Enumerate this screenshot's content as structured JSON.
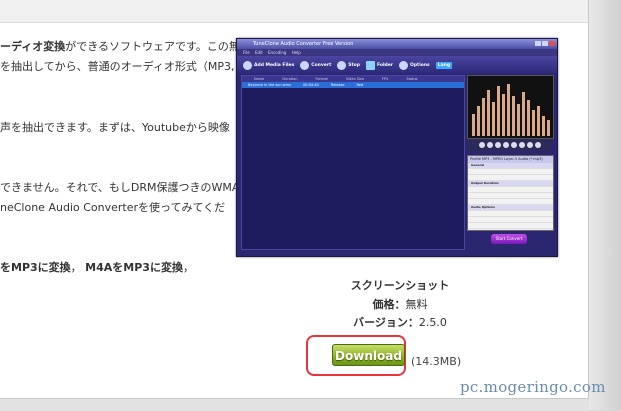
{
  "article": {
    "line1_a": "ーディオ変換",
    "line1_b": "ができるソフトウェアです。この無料",
    "line2": "を抽出してから、普通のオーディオ形式（MP3,",
    "line3": "声を抽出できます。まずは、Youtubeから映像",
    "line4": "できません。それで、もしDRM保護つきのWMAと",
    "line5": "neClone Audio Converterを使ってみてくだ",
    "line6_a": "をMP3に変換",
    "line6_b": "，",
    "line6_c": "M4AをMP3に変換",
    "line6_d": "，"
  },
  "app_screenshot": {
    "title": "TuneClone Audio Converter Free Version",
    "menu": "File  Edit  Encoding  Help",
    "toolbar": [
      "Add Media Files",
      "Convert",
      "Stop",
      "Folder",
      "Options"
    ],
    "lang_badge": "Lang",
    "list_headers": [
      "Name",
      "Duration",
      "Format",
      "Video Size",
      "FPS",
      "Status"
    ],
    "list_row": [
      "Beyonce in the sun.wmv",
      "00:04:40",
      "Release",
      "Red",
      "",
      ""
    ],
    "props_tab": "Profile  MP3 - MPEG Layer-3 Audio (*.mp3)",
    "props_lines": [
      "General",
      "Output Duration",
      "Audio Options"
    ],
    "start_button": "Start Convert"
  },
  "info": {
    "caption": "スクリーンショット",
    "price_label": "価格：",
    "price_value": "無料",
    "version_label": "バージョン：",
    "version_value": "2.5.0"
  },
  "download": {
    "label": "Download",
    "size": "(14.3MB)"
  },
  "watermark": "pc.mogeringo.com",
  "colors": {
    "download_green": "#8fb52a",
    "highlight_red": "#e8353a",
    "app_purple": "#2b2670"
  }
}
